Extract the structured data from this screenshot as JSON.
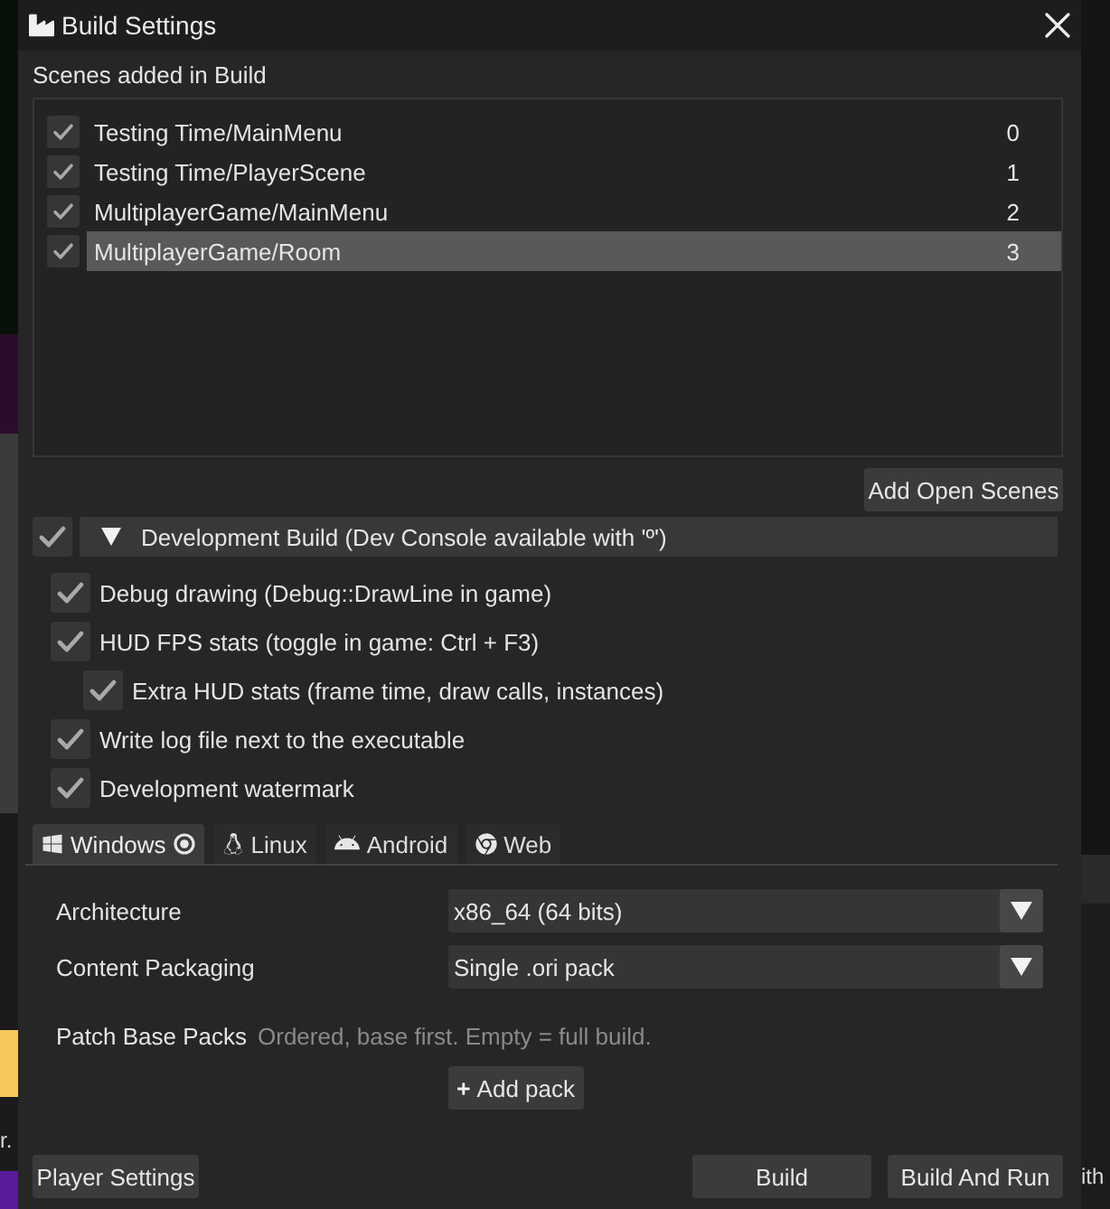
{
  "window": {
    "title": "Build Settings"
  },
  "scenes": {
    "label": "Scenes added in Build",
    "items": [
      {
        "name": "Testing Time/MainMenu",
        "index": "0",
        "checked": true,
        "selected": false
      },
      {
        "name": "Testing Time/PlayerScene",
        "index": "1",
        "checked": true,
        "selected": false
      },
      {
        "name": "MultiplayerGame/MainMenu",
        "index": "2",
        "checked": true,
        "selected": false
      },
      {
        "name": "MultiplayerGame/Room",
        "index": "3",
        "checked": true,
        "selected": true
      }
    ],
    "add_button": "Add Open Scenes"
  },
  "development_build": {
    "label": "Development Build (Dev Console available with 'º')",
    "checked": true,
    "expanded": true,
    "options": [
      {
        "label": "Debug drawing (Debug::DrawLine in game)",
        "checked": true
      },
      {
        "label": "HUD FPS stats (toggle in game: Ctrl + F3)",
        "checked": true,
        "children": [
          {
            "label": "Extra HUD stats (frame time, draw calls, instances)",
            "checked": true
          }
        ]
      },
      {
        "label": "Write log file next to the executable",
        "checked": true
      },
      {
        "label": "Development watermark",
        "checked": true
      }
    ]
  },
  "platform_tabs": [
    {
      "label": "Windows",
      "selected": true,
      "current": true
    },
    {
      "label": "Linux",
      "selected": false,
      "current": false
    },
    {
      "label": "Android",
      "selected": false,
      "current": false
    },
    {
      "label": "Web",
      "selected": false,
      "current": false
    }
  ],
  "settings": [
    {
      "kind": "dropdown",
      "label": "Architecture",
      "value": "x86_64 (64 bits)"
    },
    {
      "kind": "dropdown",
      "label": "Content Packaging",
      "value": "Single .ori pack"
    },
    {
      "kind": "pack_list",
      "label": "Patch Base Packs",
      "hint": "Ordered, base first. Empty = full build.",
      "button": "Add pack"
    }
  ],
  "footer": {
    "left_button": "Player Settings",
    "right_buttons": [
      "Build",
      "Build And Run"
    ]
  },
  "backdrop": {
    "left_fragment": "r.",
    "right_fragment": "ith"
  }
}
